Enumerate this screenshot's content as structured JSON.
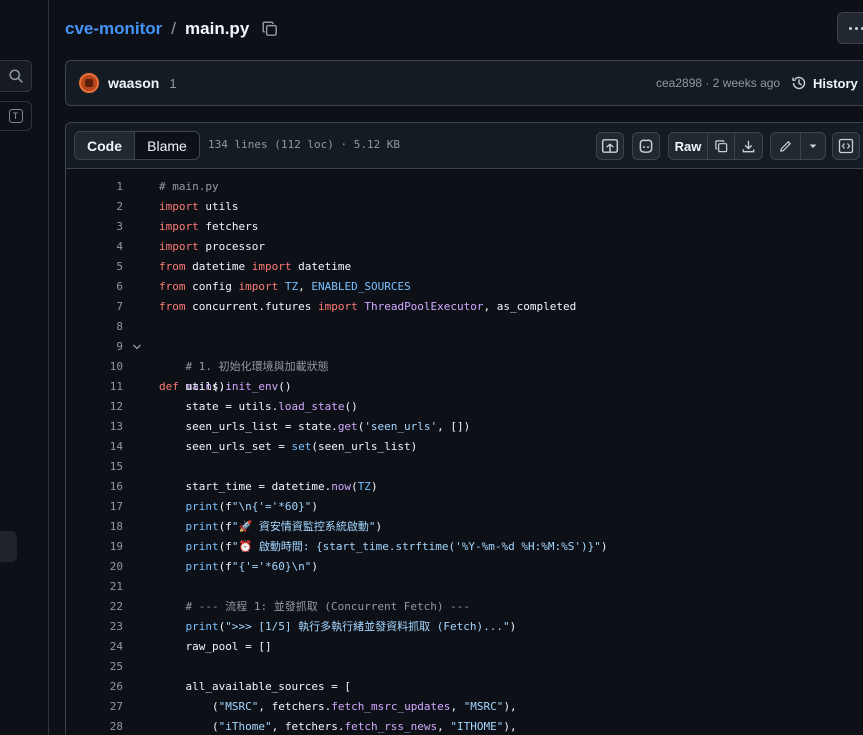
{
  "breadcrumb": {
    "repo": "cve-monitor",
    "separator": "/",
    "file": "main.py"
  },
  "commit": {
    "author": "waason",
    "count": "1",
    "meta": "cea2898 · 2 weeks ago",
    "history_label": "History"
  },
  "file_header": {
    "tabs": [
      "Code",
      "Blame"
    ],
    "info": "134 lines (112 loc) · 5.12 KB",
    "raw_label": "Raw"
  },
  "left_strip": {
    "shortcut_key": "T"
  },
  "code_lines": [
    {
      "n": "1",
      "t": "# main.py"
    },
    {
      "n": "2",
      "t": "import utils"
    },
    {
      "n": "3",
      "t": "import fetchers"
    },
    {
      "n": "4",
      "t": "import processor"
    },
    {
      "n": "5",
      "t": "from datetime import datetime"
    },
    {
      "n": "6",
      "t": "from config import TZ, ENABLED_SOURCES"
    },
    {
      "n": "7",
      "t": "from concurrent.futures import ThreadPoolExecutor, as_completed"
    },
    {
      "n": "8",
      "t": ""
    },
    {
      "n": "9",
      "t": "def main():"
    },
    {
      "n": "10",
      "t": "    # 1. 初始化環境與加載狀態"
    },
    {
      "n": "11",
      "t": "    utils.init_env()"
    },
    {
      "n": "12",
      "t": "    state = utils.load_state()"
    },
    {
      "n": "13",
      "t": "    seen_urls_list = state.get('seen_urls', [])"
    },
    {
      "n": "14",
      "t": "    seen_urls_set = set(seen_urls_list)"
    },
    {
      "n": "15",
      "t": ""
    },
    {
      "n": "16",
      "t": "    start_time = datetime.now(TZ)"
    },
    {
      "n": "17",
      "t": "    print(f\"\\n{'='*60}\")"
    },
    {
      "n": "18",
      "t": "    print(f\"🚀 資安情資監控系統啟動\")"
    },
    {
      "n": "19",
      "t": "    print(f\"⏰ 啟動時間: {start_time.strftime('%Y-%m-%d %H:%M:%S')}\")"
    },
    {
      "n": "20",
      "t": "    print(f\"{'='*60}\\n\")"
    },
    {
      "n": "21",
      "t": ""
    },
    {
      "n": "22",
      "t": "    # --- 流程 1: 並發抓取 (Concurrent Fetch) ---"
    },
    {
      "n": "23",
      "t": "    print(\">>> [1/5] 執行多執行緒並發資料抓取 (Fetch)...\")"
    },
    {
      "n": "24",
      "t": "    raw_pool = []"
    },
    {
      "n": "25",
      "t": ""
    },
    {
      "n": "26",
      "t": "    all_available_sources = ["
    },
    {
      "n": "27",
      "t": "        (\"MSRC\", fetchers.fetch_msrc_updates, \"MSRC\"),"
    },
    {
      "n": "28",
      "t": "        (\"iThome\", fetchers.fetch_rss_news, \"ITHOME\"),"
    }
  ],
  "colors": {
    "keyword": "#ff7b72",
    "function": "#d2a8ff",
    "string": "#a5d6ff",
    "comment": "#9198a1",
    "builtin": "#79c0ff",
    "link": "#4493f8"
  },
  "icons": [
    "search-icon",
    "copy-icon",
    "kebab-icon",
    "history-icon",
    "symbols-icon",
    "copilot-icon",
    "download-icon",
    "pencil-icon",
    "chevron-down-icon",
    "code-panel-icon",
    "fold-chevron-icon"
  ]
}
